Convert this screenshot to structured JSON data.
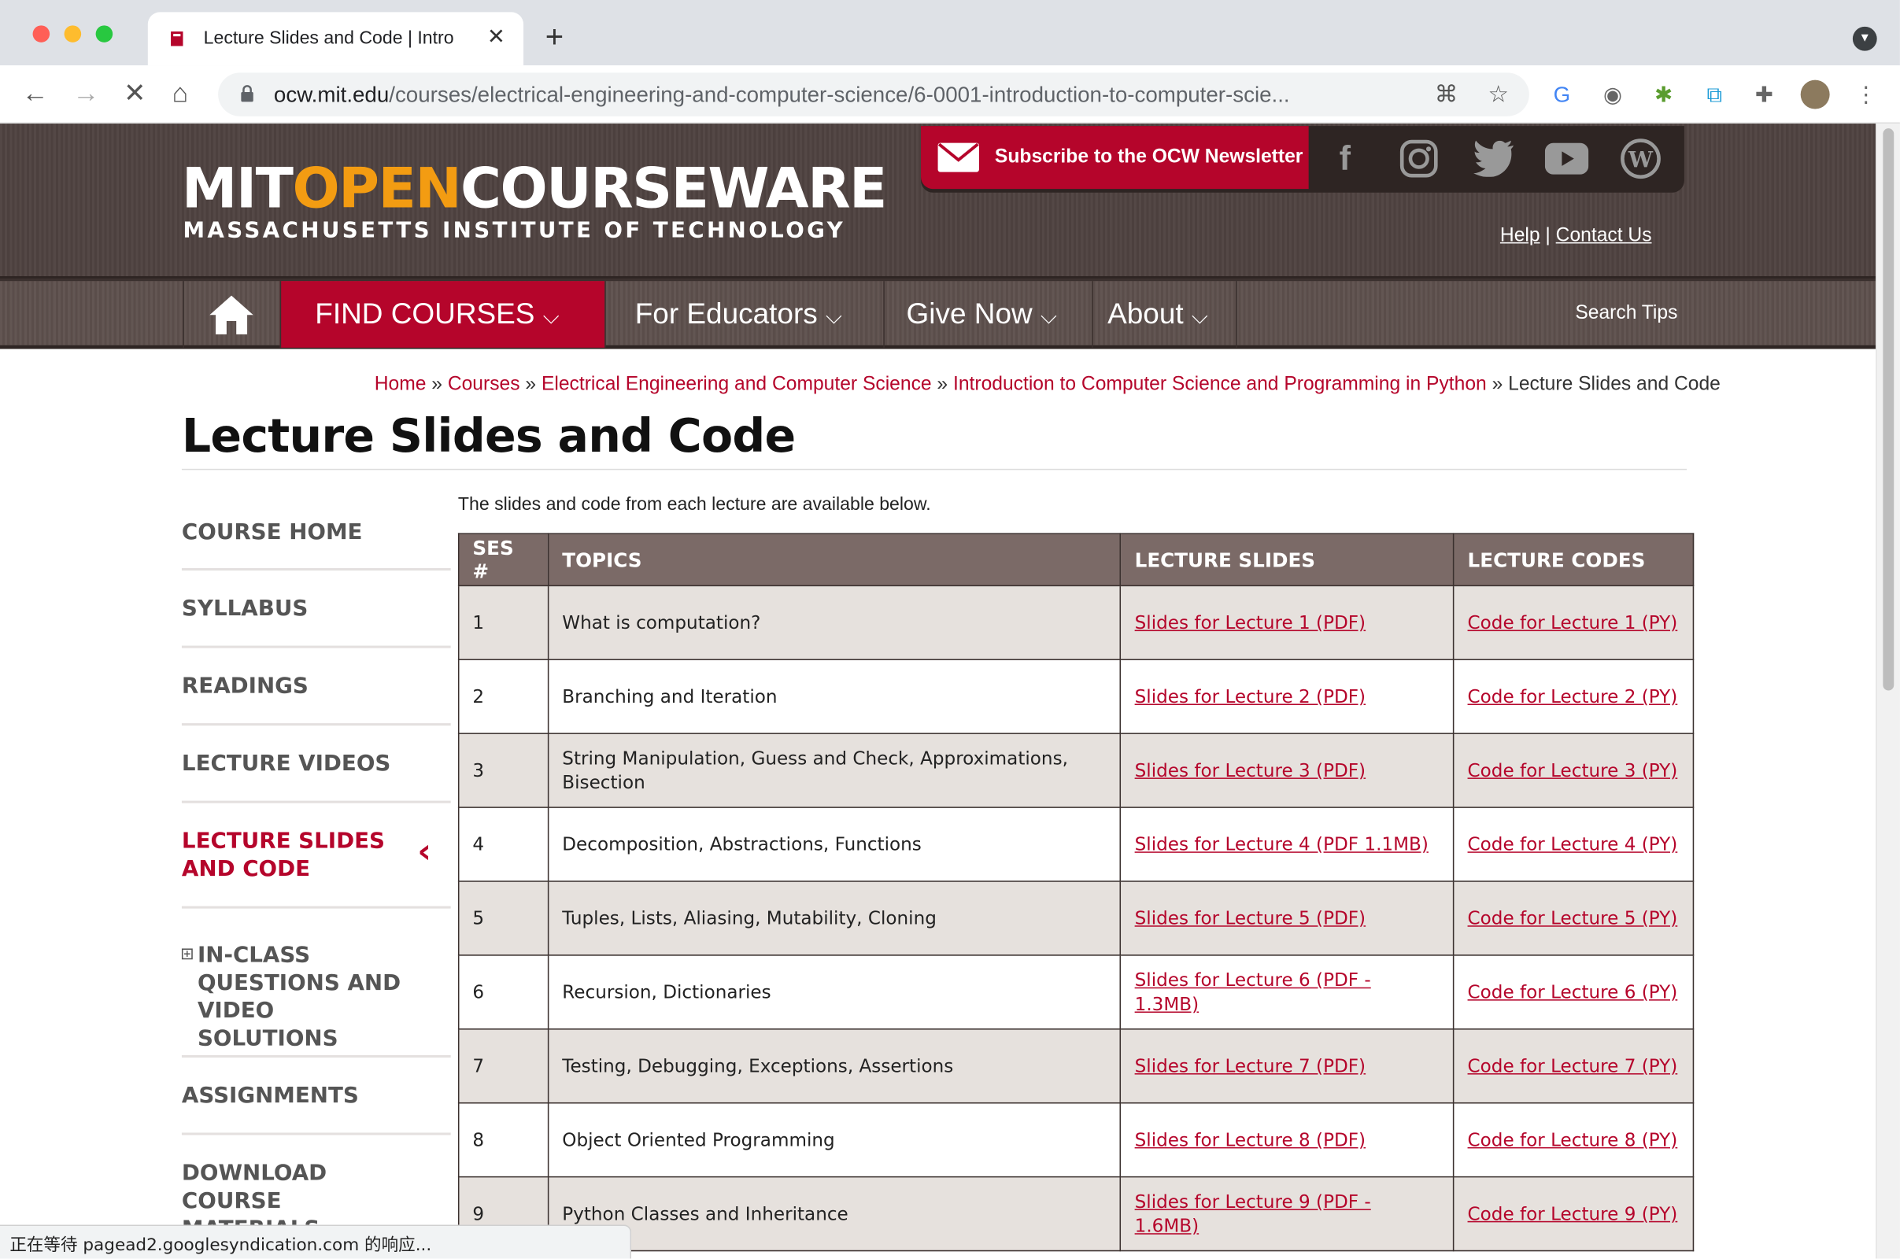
{
  "browser": {
    "tab_title": "Lecture Slides and Code | Intro",
    "url_host": "ocw.mit.edu",
    "url_path": "/courses/electrical-engineering-and-computer-science/6-0001-introduction-to-computer-scie...",
    "status_text": "正在等待 pagead2.googlesyndication.com 的响应..."
  },
  "header": {
    "logo_mit": "MIT",
    "logo_open": "OPEN",
    "logo_courseware": "COURSEWARE",
    "logo_sub": "MASSACHUSETTS INSTITUTE OF TECHNOLOGY",
    "newsletter_label": "Subscribe to the OCW Newsletter",
    "help": "Help",
    "contact": "Contact Us"
  },
  "nav": {
    "find_courses": "FIND COURSES",
    "for_educators": "For Educators",
    "give_now": "Give Now",
    "about": "About",
    "search_tips": "Search Tips"
  },
  "breadcrumb": {
    "home": "Home",
    "courses": "Courses",
    "department": "Electrical Engineering and Computer Science",
    "course": "Introduction to Computer Science and Programming in Python",
    "current": "Lecture Slides and Code"
  },
  "page": {
    "title": "Lecture Slides and Code",
    "intro": "The slides and code from each lecture are available below."
  },
  "sidebar": {
    "items": [
      {
        "label": "COURSE HOME"
      },
      {
        "label": "SYLLABUS"
      },
      {
        "label": "READINGS"
      },
      {
        "label": "LECTURE VIDEOS"
      },
      {
        "label": "LECTURE SLIDES AND CODE"
      },
      {
        "label": "IN-CLASS QUESTIONS AND VIDEO SOLUTIONS"
      },
      {
        "label": "ASSIGNMENTS"
      },
      {
        "label": "DOWNLOAD COURSE MATERIALS"
      }
    ]
  },
  "table": {
    "headers": [
      "SES #",
      "TOPICS",
      "LECTURE SLIDES",
      "LECTURE CODES"
    ],
    "rows": [
      {
        "ses": "1",
        "topic": "What is computation?",
        "slides": "Slides for Lecture 1 (PDF)",
        "code": "Code for Lecture 1 (PY)"
      },
      {
        "ses": "2",
        "topic": "Branching and Iteration",
        "slides": "Slides for Lecture 2 (PDF)",
        "code": "Code for Lecture 2 (PY)"
      },
      {
        "ses": "3",
        "topic": "String Manipulation, Guess and Check, Approximations, Bisection",
        "slides": "Slides for Lecture 3 (PDF)",
        "code": "Code for Lecture 3 (PY)"
      },
      {
        "ses": "4",
        "topic": "Decomposition, Abstractions, Functions",
        "slides": "Slides for Lecture 4 (PDF 1.1MB)",
        "code": "Code for Lecture 4 (PY)"
      },
      {
        "ses": "5",
        "topic": "Tuples, Lists, Aliasing, Mutability, Cloning",
        "slides": "Slides for Lecture 5 (PDF)",
        "code": "Code for Lecture 5 (PY)"
      },
      {
        "ses": "6",
        "topic": "Recursion, Dictionaries",
        "slides": "Slides for Lecture 6 (PDF - 1.3MB)",
        "code": "Code for Lecture 6 (PY)"
      },
      {
        "ses": "7",
        "topic": "Testing, Debugging, Exceptions, Assertions",
        "slides": "Slides for Lecture 7 (PDF)",
        "code": "Code for Lecture 7 (PY)"
      },
      {
        "ses": "8",
        "topic": "Object Oriented Programming",
        "slides": "Slides for Lecture 8 (PDF)",
        "code": "Code for Lecture 8 (PY)"
      },
      {
        "ses": "9",
        "topic": "Python Classes and Inheritance",
        "slides": "Slides for Lecture 9 (PDF - 1.6MB)",
        "code": "Code for Lecture 9 (PY)"
      }
    ]
  },
  "colors": {
    "accent": "#b5052b",
    "header_bg": "#4e4240",
    "table_header": "#7b6a67",
    "row_alt": "#e6e1dd"
  }
}
